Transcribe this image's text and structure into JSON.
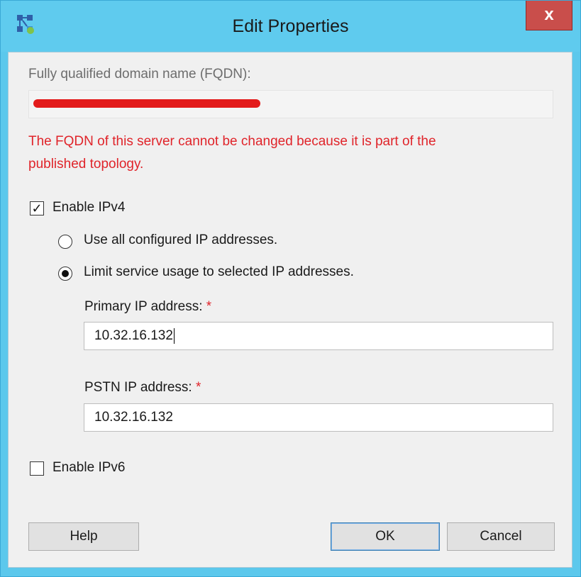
{
  "window": {
    "title": "Edit Properties",
    "close_label": "x",
    "app_icon": "topology-builder-icon"
  },
  "fqdn": {
    "label": "Fully qualified domain name (FQDN):",
    "value_redacted": true,
    "error_line1": "The FQDN of this server cannot be changed because it is part of the",
    "error_line2": "published topology."
  },
  "ipv4": {
    "label": "Enable IPv4",
    "checked": true,
    "option_all_label": "Use all configured IP addresses.",
    "option_limit_label": "Limit service usage to selected IP addresses.",
    "selected_option": "limit",
    "primary_label": "Primary IP address:",
    "primary_value": "10.32.16.132",
    "pstn_label": "PSTN IP address:",
    "pstn_value": "10.32.16.132",
    "required_mark": "*"
  },
  "ipv6": {
    "label": "Enable IPv6",
    "checked": false
  },
  "buttons": {
    "help": "Help",
    "ok": "OK",
    "cancel": "Cancel"
  },
  "colors": {
    "title_bar": "#5fcbee",
    "close_button": "#c94e4b",
    "error_text": "#e0242a",
    "redaction": "#e31b1b"
  }
}
